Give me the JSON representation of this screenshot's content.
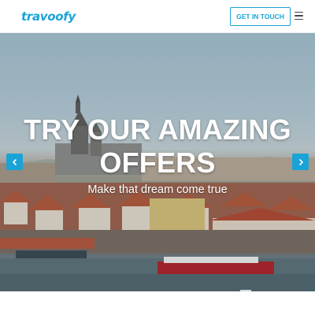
{
  "brand": {
    "logo_text": "travoofy",
    "accent": "#1aa3d6"
  },
  "header": {
    "cta_label": "GET IN TOUCH",
    "menu_icon": "hamburger-menu-icon"
  },
  "hero": {
    "headline_line1": "TRY OUR AMAZING",
    "headline_line2": "OFFERS",
    "tagline": "Make that dream come true",
    "prev_icon": "chevron-left-icon",
    "next_icon": "chevron-right-icon"
  }
}
